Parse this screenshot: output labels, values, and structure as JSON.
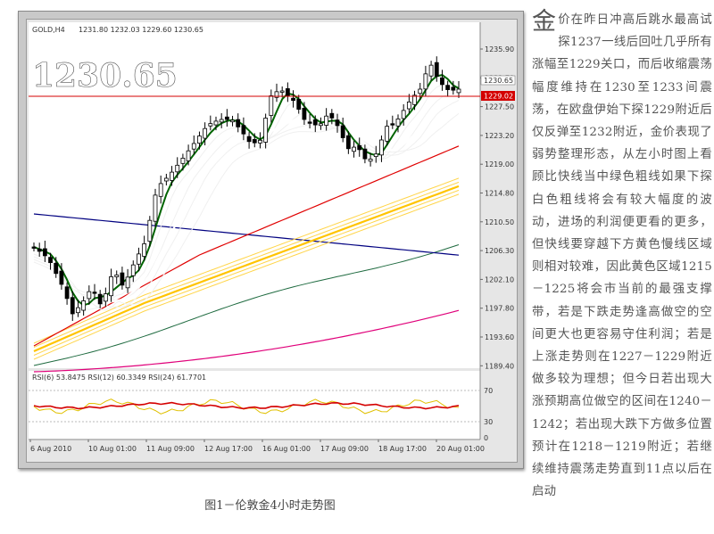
{
  "chart": {
    "symbol_label": "GOLD,H4",
    "ohlc_label": "1231.80 1232.03 1229.60 1230.65",
    "big_price": "1230.65",
    "current_price_tag": "1230.65",
    "hline_price_tag": "1229.02",
    "y_ticks": [
      "1235.90",
      "1231.70",
      "1227.50",
      "1223.20",
      "1219.00",
      "1214.80",
      "1210.50",
      "1206.30",
      "1202.10",
      "1197.80",
      "1193.60",
      "1189.40"
    ],
    "x_ticks": [
      "6 Aug 2010",
      "10 Aug 01:00",
      "11 Aug 09:00",
      "12 Aug 17:00",
      "16 Aug 01:00",
      "17 Aug 09:00",
      "18 Aug 17:00",
      "20 Aug 01:00"
    ],
    "rsi_label": "RSI(6) 53.8475  RSI(12) 60.3349  RSI(24) 61.7701",
    "rsi_levels": [
      "70",
      "30",
      "0"
    ],
    "colors": {
      "bg": "#ffffff",
      "hline": "#d40000",
      "green": "#006400",
      "white_ma": "#ffffff",
      "yellow": "#ffd54a",
      "red": "#e00000",
      "navy": "#000080",
      "magenta": "#e0007a",
      "dkgreen": "#1f6b40"
    }
  },
  "caption": "图1－伦敦金4小时走势图",
  "article": {
    "dropcap": "金",
    "text": "价在昨日冲高后跳水最高试探1237一线后回吐几乎所有涨幅至1229关口，而后收缩震荡幅度维持在1230至1233间震荡，在欧盘伊始下探1229附近后仅反弹至1232附近，金价表现了弱势整理形态，从左小时图上看顾比快线当中绿色粗线如果下探白色粗线将会有较大幅度的波动，进场的利润便更看的更多，但快线要穿越下方黄色慢线区域则相对较难，因此黄色区域1215－1225将会市当前的最强支撑带，若是下跌走势逢高做空的空间更大也更容易守住利润；若是上涨走势则在1227－1229附近做多较为理想；但今日若出现大涨预期高位做空的区间在1240－1242；若出现大跌下方做多位置预计在1218－1219附近；若继续维持震荡走势直到11点以后在启动"
  }
}
